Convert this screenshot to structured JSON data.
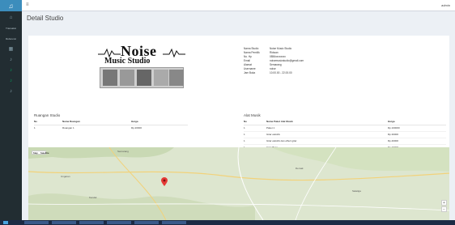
{
  "sidebar": {
    "logo_icon": "headphones-icon",
    "items": [
      {
        "icon": "home-icon",
        "label": ""
      },
      {
        "icon": "dot-icon",
        "label": "Transaksi"
      },
      {
        "icon": "dot-icon",
        "label": "Referensi"
      },
      {
        "icon": "grid-icon",
        "label": ""
      },
      {
        "icon": "music-icon",
        "label": ""
      },
      {
        "icon": "music-icon",
        "label": ""
      },
      {
        "icon": "music-icon",
        "label": ""
      },
      {
        "icon": "music-icon",
        "label": ""
      }
    ]
  },
  "topbar": {
    "menu_icon": "menu-icon",
    "user": "admin"
  },
  "page": {
    "title": "Detail Studio"
  },
  "logo": {
    "noise": "Noise",
    "music_studio": "Music Studio"
  },
  "studio_info": [
    {
      "key": "Nama Studio",
      "value": "Noise Music Studio"
    },
    {
      "key": "Nama Pemilik",
      "value": "Ridwan"
    },
    {
      "key": "No. Hp",
      "value": "0856xxxxxxxx"
    },
    {
      "key": "Email",
      "value": "noisemusicstudio@gmail.com"
    },
    {
      "key": "Alamat",
      "value": "Semarang"
    },
    {
      "key": "Username",
      "value": "noise"
    },
    {
      "key": "Jam Buka",
      "value": "10.00.00 - 22.00.00"
    }
  ],
  "ruangan": {
    "title": "Ruangan Studio",
    "headers": [
      "No",
      "Nama Ruangan",
      "Harga"
    ],
    "rows": [
      [
        "1",
        "Ruangan 1",
        "Rp.20000"
      ]
    ]
  },
  "alat": {
    "title": "Alat Musik",
    "headers": [
      "No",
      "Nama Paket Alat Musik",
      "Harga"
    ],
    "rows": [
      [
        "1",
        "Paket 1",
        "Rp.100000"
      ],
      [
        "1",
        "Gitar elektrik",
        "Rp.30000"
      ],
      [
        "1",
        "Gitar elektrik dan effect gitar",
        "Rp.40000"
      ],
      [
        "1",
        "Gitar Bass",
        "Rp.20000"
      ],
      [
        "1",
        "Gitar Bass + effect",
        "Rp.30000"
      ],
      [
        "1",
        "drum set + cymbal",
        "Rp.50000"
      ]
    ]
  },
  "map": {
    "toggle": [
      "Map",
      "Satellite"
    ],
    "labels": [
      "Semarang",
      "Ungaran",
      "Demak",
      "Kendal",
      "Salatiga"
    ],
    "pin_color": "#e53935",
    "zoom_in": "+",
    "zoom_out": "−"
  },
  "colors": {
    "sidebar": "#222d32",
    "accent": "#3c8dbc",
    "green": "#00a65a"
  }
}
